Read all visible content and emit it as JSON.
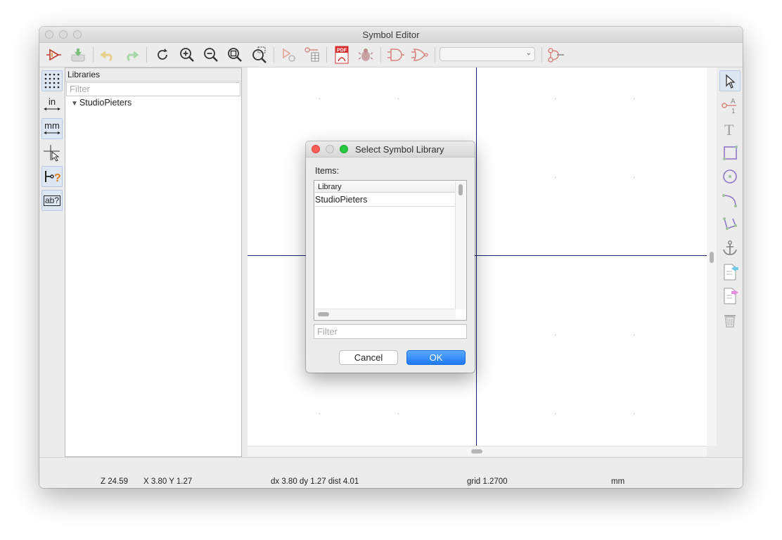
{
  "window": {
    "title": "Symbol Editor"
  },
  "toolbar": {
    "icons": [
      "new-symbol-icon",
      "save-icon",
      "undo-icon",
      "redo-icon",
      "refresh-icon",
      "zoom-in-icon",
      "zoom-out-icon",
      "zoom-fit-icon",
      "zoom-selection-icon",
      "symbol-properties-icon",
      "pin-table-icon",
      "export-pdf-icon",
      "check-symbol-icon",
      "deMorgan-normal-icon",
      "deMorgan-alternate-icon",
      "symbol-units-select",
      "view-doc-icon"
    ],
    "unit_select_value": ""
  },
  "left_toolbar": {
    "in_label": "in",
    "mm_label": "mm",
    "ab_label": "ab?"
  },
  "libraries_panel": {
    "header": "Libraries",
    "filter_placeholder": "Filter",
    "items": [
      {
        "label": "StudioPieters",
        "expanded": true
      }
    ]
  },
  "right_toolbar": {
    "icons": [
      "select-arrow-icon",
      "add-pin-icon",
      "add-text-icon",
      "add-rectangle-icon",
      "add-circle-icon",
      "add-arc-icon",
      "add-polyline-icon",
      "anchor-icon",
      "import-symbol-icon",
      "export-symbol-icon",
      "delete-icon"
    ]
  },
  "status": {
    "zoom": "Z 24.59",
    "xy": "X 3.80  Y 1.27",
    "delta": "dx 3.80  dy 1.27  dist 4.01",
    "grid": "grid 1.2700",
    "units": "mm"
  },
  "dialog": {
    "title": "Select Symbol Library",
    "items_label": "Items:",
    "column_header": "Library",
    "rows": [
      "StudioPieters"
    ],
    "filter_placeholder": "Filter",
    "cancel_label": "Cancel",
    "ok_label": "OK"
  },
  "colors": {
    "axis": "#1b1f6e",
    "ok_button": "#1f7af2",
    "close_button": "#fe5f57",
    "zoom_button": "#28c840"
  }
}
